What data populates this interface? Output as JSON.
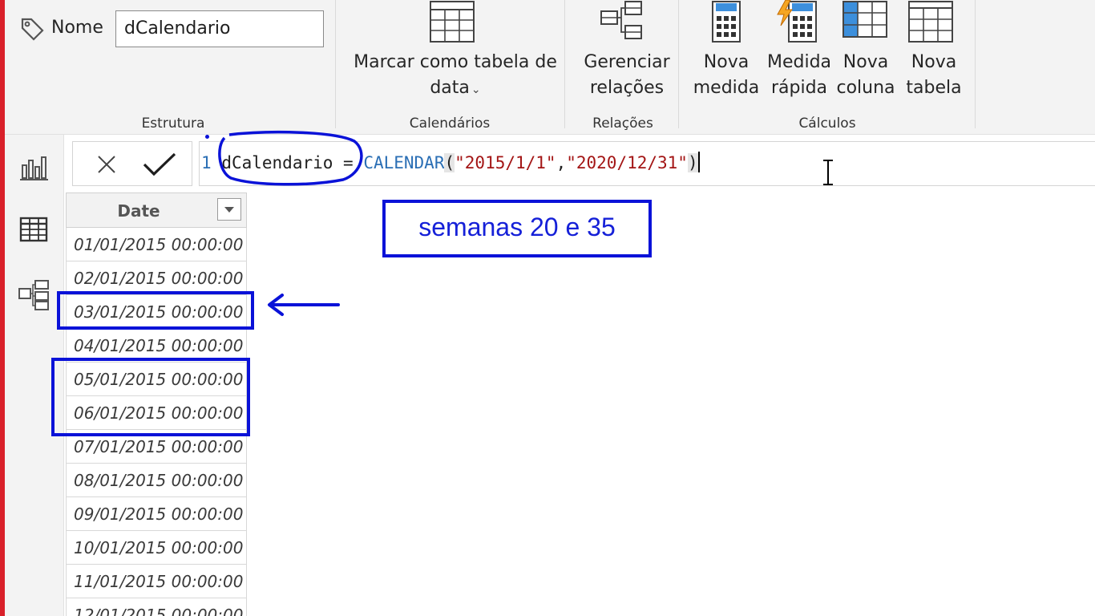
{
  "ribbon": {
    "name_label": "Nome",
    "name_value": "dCalendario",
    "groups": {
      "estrutura": "Estrutura",
      "calendarios": "Calendários",
      "relacoes": "Relações",
      "calculos": "Cálculos"
    },
    "buttons": {
      "mark_table_line1": "Marcar como tabela de",
      "mark_table_line2": "data",
      "manage_rel_line1": "Gerenciar",
      "manage_rel_line2": "relações",
      "new_measure_line1": "Nova",
      "new_measure_line2": "medida",
      "quick_measure_line1": "Medida",
      "quick_measure_line2": "rápida",
      "new_column_line1": "Nova",
      "new_column_line2": "coluna",
      "new_table_line1": "Nova",
      "new_table_line2": "tabela"
    }
  },
  "formula": {
    "line_number": "1",
    "table_name": "dCalendario",
    "equals": " = ",
    "function": "CALENDAR",
    "open_paren": "(",
    "arg1": "\"2015/1/1\"",
    "comma": ",",
    "arg2": "\"2020/12/31\"",
    "close_paren": ")"
  },
  "table": {
    "column": "Date",
    "rows": [
      "01/01/2015 00:00:00",
      "02/01/2015 00:00:00",
      "03/01/2015 00:00:00",
      "04/01/2015 00:00:00",
      "05/01/2015 00:00:00",
      "06/01/2015 00:00:00",
      "07/01/2015 00:00:00",
      "08/01/2015 00:00:00",
      "09/01/2015 00:00:00",
      "10/01/2015 00:00:00",
      "11/01/2015 00:00:00",
      "12/01/2015 00:00:00"
    ]
  },
  "annotation": {
    "text": "semanas 20 e 35",
    "color": "#0a12d8"
  },
  "colors": {
    "accent_strip": "#d9202a",
    "dax_function": "#2b6fb5",
    "dax_string": "#a31515"
  }
}
